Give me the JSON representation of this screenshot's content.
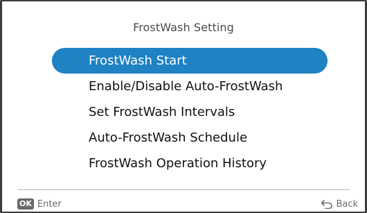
{
  "header": {
    "title": "FrostWash Setting"
  },
  "menu": {
    "items": [
      {
        "label": "FrostWash Start",
        "selected": true
      },
      {
        "label": "Enable/Disable Auto-FrostWash",
        "selected": false
      },
      {
        "label": "Set FrostWash Intervals",
        "selected": false
      },
      {
        "label": "Auto-FrostWash Schedule",
        "selected": false
      },
      {
        "label": "FrostWash Operation History",
        "selected": false
      }
    ]
  },
  "footer": {
    "ok_badge": "OK",
    "enter_label": "Enter",
    "back_label": "Back",
    "back_icon": "return-arrow-icon"
  },
  "colors": {
    "selection": "#1e82c3",
    "text": "#111111",
    "muted": "#6a6a6a",
    "bezel": "#3a3a3a"
  }
}
